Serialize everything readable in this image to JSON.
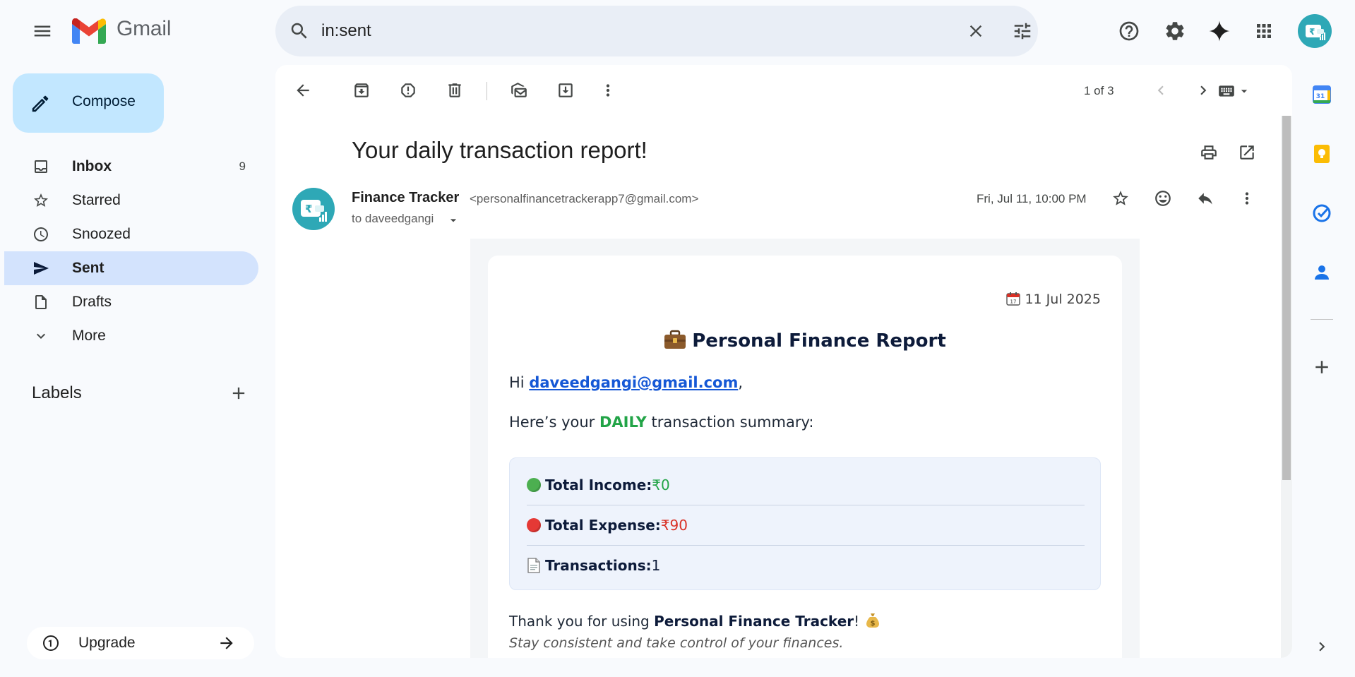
{
  "app": {
    "logo_text": "Gmail"
  },
  "search": {
    "query": "in:sent"
  },
  "compose": {
    "label": "Compose"
  },
  "nav": [
    {
      "label": "Inbox",
      "count": "9",
      "bold": true
    },
    {
      "label": "Starred"
    },
    {
      "label": "Snoozed"
    },
    {
      "label": "Sent",
      "bold": true,
      "active": true
    },
    {
      "label": "Drafts"
    },
    {
      "label": "More"
    }
  ],
  "labels": {
    "title": "Labels"
  },
  "upgrade": {
    "label": "Upgrade"
  },
  "toolbar": {
    "pager": "1 of 3"
  },
  "message": {
    "subject": "Your daily transaction report!",
    "sender_name": "Finance Tracker",
    "sender_email": "<personalfinancetrackerapp7@gmail.com>",
    "recipient": "to daveedgangi",
    "date": "Fri, Jul 11, 10:00 PM"
  },
  "report": {
    "date": "11 Jul 2025",
    "title": "Personal Finance Report",
    "greeting_prefix": "Hi ",
    "greeting_email": "daveedgangi@gmail.com",
    "greeting_suffix": ",",
    "summary_prefix": "Here’s your ",
    "summary_period": "DAILY",
    "summary_suffix": " transaction summary:",
    "income_label": "Total Income:",
    "income_value": "₹0",
    "expense_label": "Total Expense:",
    "expense_value": "₹90",
    "transactions_label": "Transactions:",
    "transactions_value": "1",
    "thanks_prefix": "Thank you for using ",
    "thanks_brand": "Personal Finance Tracker",
    "thanks_suffix": "! ",
    "tagline": "Stay consistent and take control of your finances."
  },
  "colors": {
    "accent": "#c2e7ff",
    "active_nav": "#d3e3fd",
    "income": "#22a447",
    "expense": "#d93025",
    "link": "#1558d6"
  },
  "icons": [
    "menu-icon",
    "gmail-logo-icon",
    "search-icon",
    "clear-search-icon",
    "search-options-icon",
    "help-icon",
    "settings-icon",
    "gemini-icon",
    "apps-icon",
    "avatar",
    "pencil-icon",
    "inbox-icon",
    "star-icon",
    "clock-icon",
    "send-icon",
    "draft-icon",
    "chevron-down-icon",
    "plus-icon",
    "upgrade-icon",
    "arrow-right-icon",
    "back-icon",
    "archive-icon",
    "spam-icon",
    "delete-icon",
    "mark-unread-icon",
    "move-to-icon",
    "more-vert-icon",
    "prev-icon",
    "next-icon",
    "keyboard-icon",
    "print-icon",
    "open-new-window-icon",
    "emoji-icon",
    "reply-icon",
    "calendar-icon",
    "keep-icon",
    "tasks-icon",
    "contacts-icon"
  ]
}
